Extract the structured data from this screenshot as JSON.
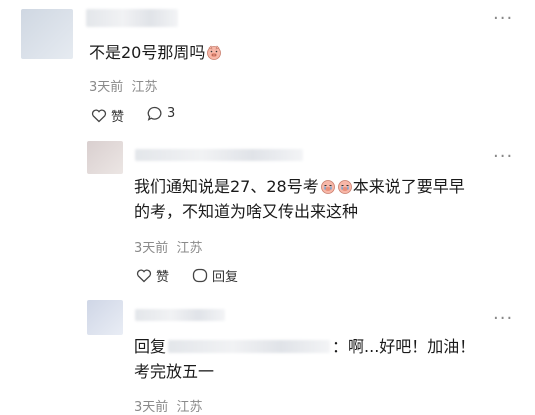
{
  "comments": [
    {
      "text": "不是20号那周吗",
      "time": "3天前",
      "location": "江苏",
      "like_label": "赞",
      "reply_count": "3",
      "emoji_icon": "pig-face-icon"
    },
    {
      "text_line1": "我们通知说是27、28号考",
      "text_line1_tail": "本来说了要早早",
      "text_line2": "的考，不知道为啥又传出来这种",
      "time": "3天前",
      "location": "江苏",
      "like_label": "赞",
      "reply_label": "回复",
      "emoji_icon": "crying-pig-icon"
    },
    {
      "reply_prefix": "回复",
      "text_line1_tail": "：啊...好吧！加油！",
      "text_line2": "考完放五一",
      "time": "3天前",
      "location": "江苏"
    }
  ],
  "colors": {
    "meta": "#8a8a8a",
    "text": "#1a1a1a"
  }
}
